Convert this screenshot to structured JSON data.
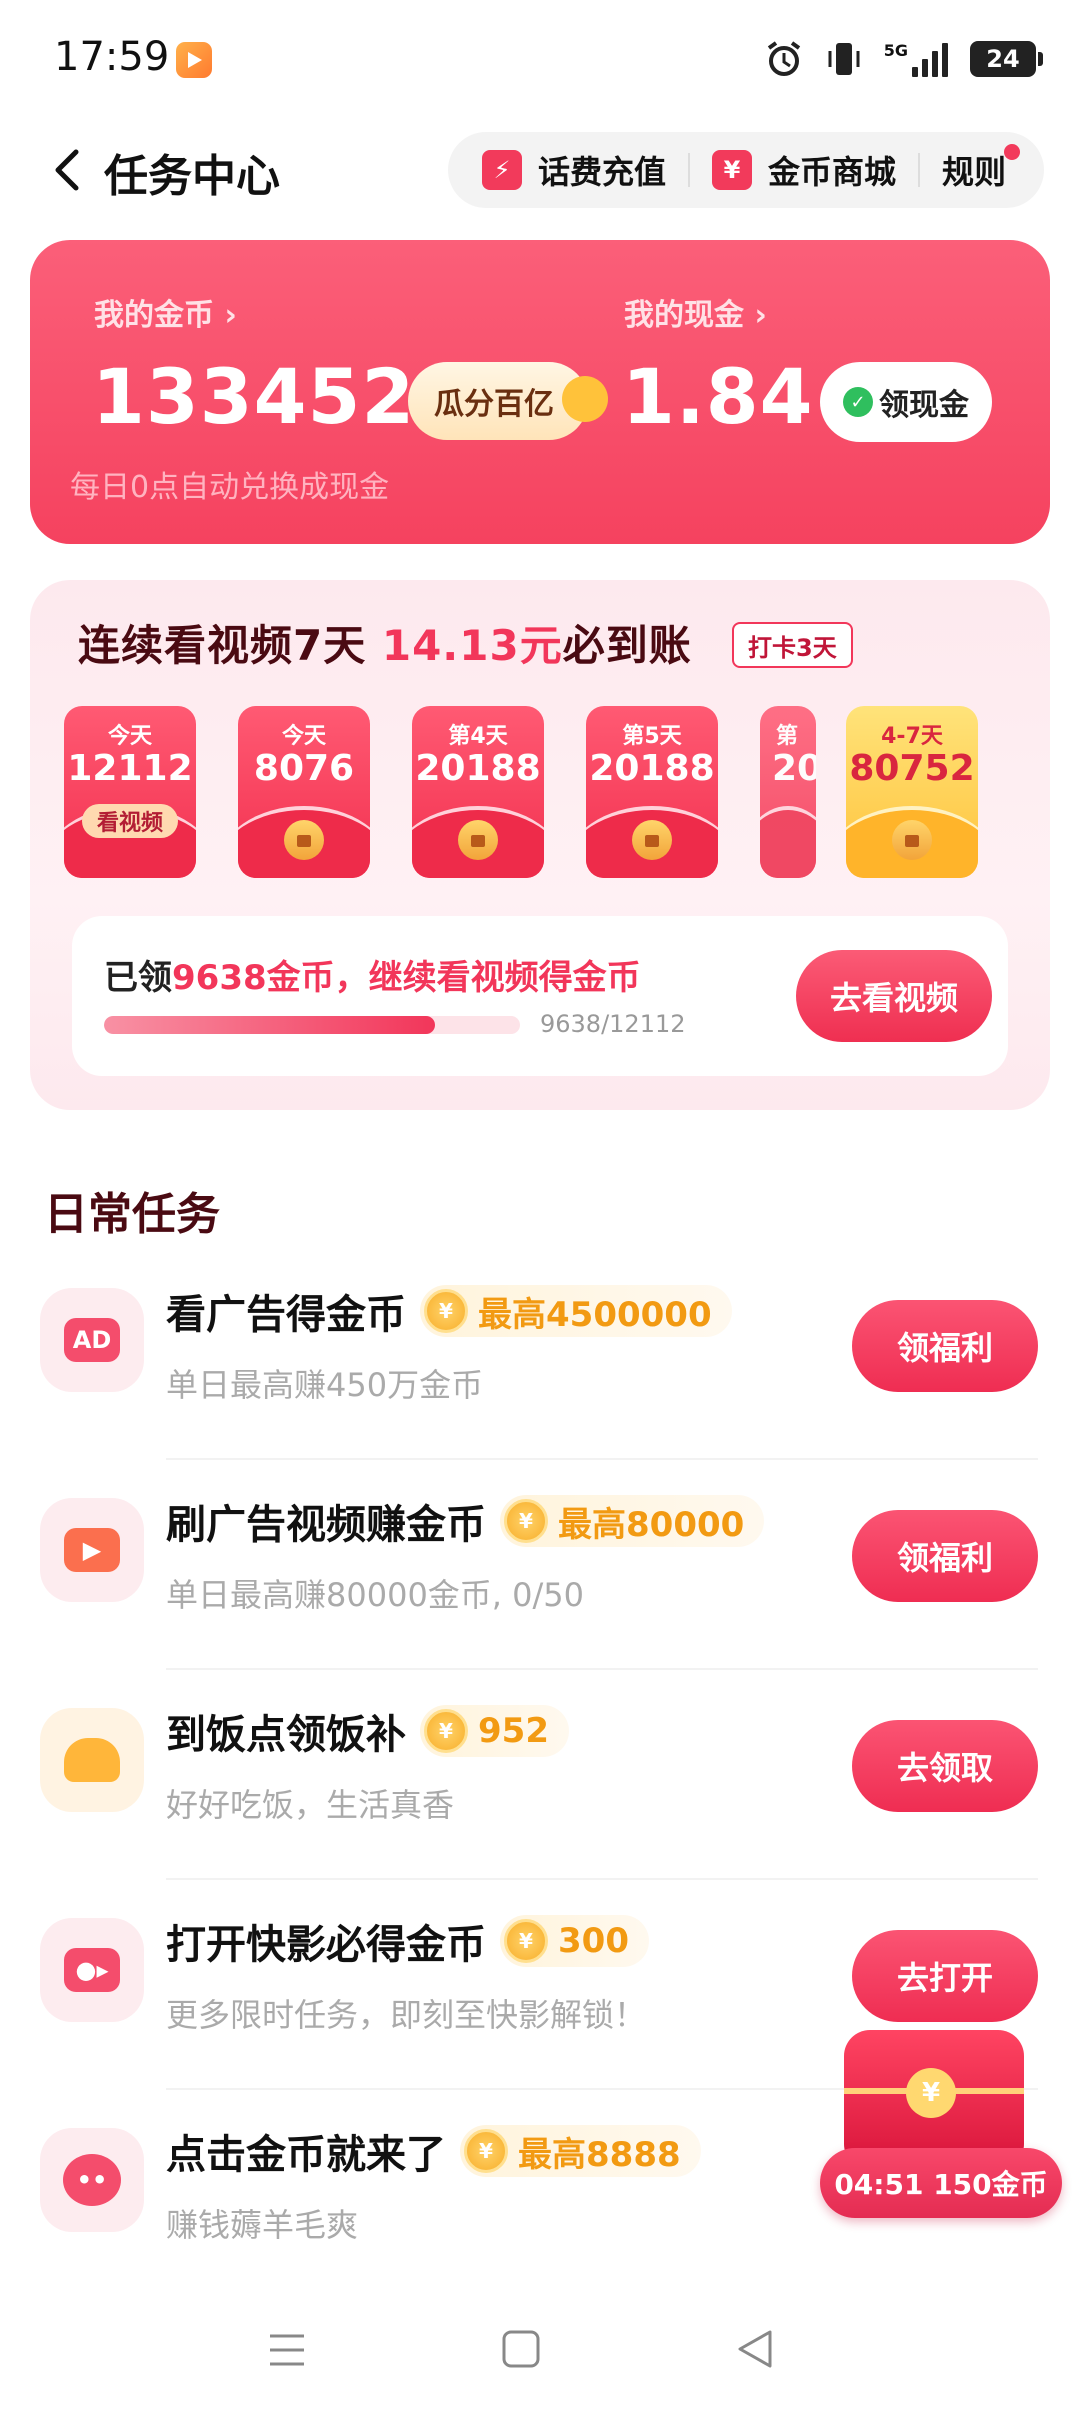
{
  "status": {
    "time": "17:59",
    "network": "5G",
    "battery": "24"
  },
  "nav": {
    "title": "任务中心",
    "recharge": "话费充值",
    "mall": "金币商城",
    "rules": "规则"
  },
  "wallet": {
    "coins_label": "我的金币",
    "coins_value": "133452",
    "share_btn": "瓜分百亿",
    "cash_label": "我的现金",
    "cash_value": "1.84",
    "claim_btn": "领现金",
    "note": "每日0点自动兑换成现金"
  },
  "checkin": {
    "title_pre": "连续看视频7天",
    "title_amount": "14.13元",
    "title_post": "必到账",
    "badge": "打卡3天",
    "envelopes": [
      {
        "day": "今天",
        "amount": "12112",
        "action": "看视频"
      },
      {
        "day": "今天",
        "amount": "8076"
      },
      {
        "day": "第4天",
        "amount": "20188"
      },
      {
        "day": "第5天",
        "amount": "20188"
      },
      {
        "day": "第",
        "amount": "20"
      },
      {
        "day": "4-7天",
        "amount": "80752"
      }
    ],
    "progress_pre": "已领",
    "progress_hl": "9638金币，继续看视频得金币",
    "progress_value": 9638,
    "progress_total": 12112,
    "progress_text": "9638/12112",
    "watch_btn": "去看视频"
  },
  "daily": {
    "title": "日常任务",
    "tasks": [
      {
        "name": "看广告得金币",
        "reward": "最高4500000",
        "desc": "单日最高赚450万金币",
        "btn": "领福利",
        "icon": "ad-icon"
      },
      {
        "name": "刷广告视频赚金币",
        "reward": "最高80000",
        "desc": "单日最高赚80000金币, 0/50",
        "btn": "领福利",
        "icon": "video-icon"
      },
      {
        "name": "到饭点领饭补",
        "reward": "952",
        "desc": "好好吃饭，生活真香",
        "btn": "去领取",
        "icon": "meal-icon"
      },
      {
        "name": "打开快影必得金币",
        "reward": "300",
        "desc": "更多限时任务，即刻至快影解锁！",
        "btn": "去打开",
        "icon": "camera-icon"
      },
      {
        "name": "点击金币就来了",
        "reward": "最高8888",
        "desc": "赚钱薅羊毛爽",
        "btn": "",
        "icon": "pig-icon"
      }
    ]
  },
  "float_reward": {
    "text": "04:51 150金币"
  },
  "colors": {
    "accent": "#f2365a",
    "card": "#f5425f",
    "gold": "#f29a12"
  }
}
